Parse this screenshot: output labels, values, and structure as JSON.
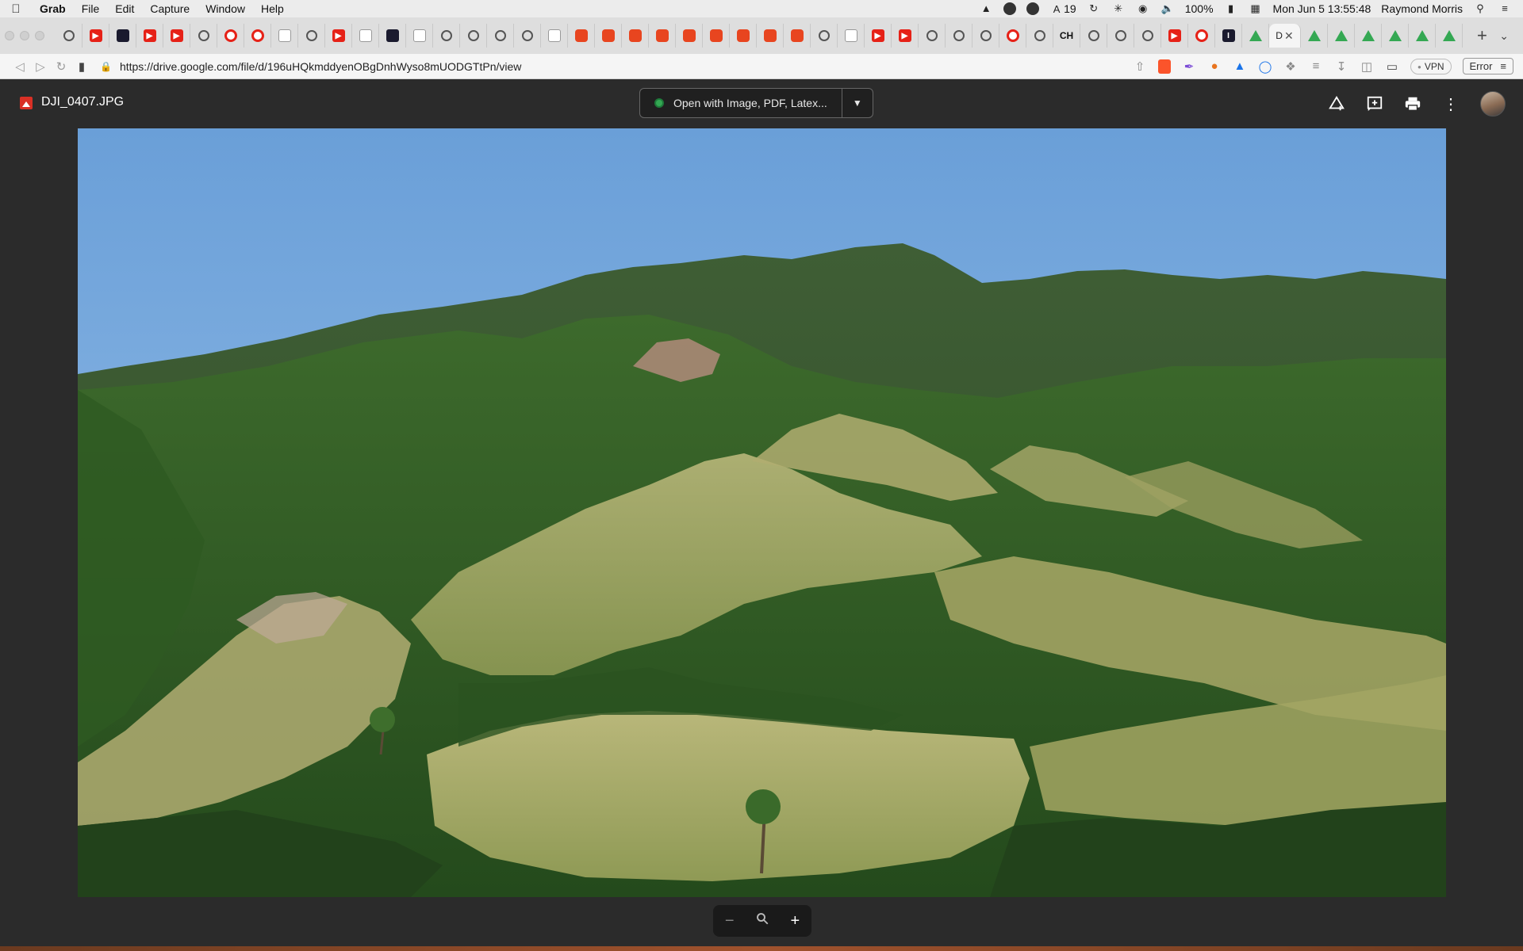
{
  "menubar": {
    "app": "Grab",
    "items": [
      "File",
      "Edit",
      "Capture",
      "Window",
      "Help"
    ],
    "badge_count": "19",
    "battery": "100%",
    "datetime": "Mon Jun 5  13:55:48",
    "user": "Raymond Morris"
  },
  "browser": {
    "url": "https://drive.google.com/file/d/196uHQkmddyenOBgDnhWyso8mUODGTtPn/view",
    "active_tab_label": "D",
    "tab_label_ch": "CH",
    "tab_label_i": "I",
    "vpn_label": "VPN",
    "error_label": "Error"
  },
  "viewer": {
    "file_name": "DJI_0407.JPG",
    "open_with_label": "Open with Image, PDF, Latex..."
  },
  "icons": {
    "zoom_out": "minus-icon",
    "zoom_reset": "magnifier-icon",
    "zoom_in": "plus-icon"
  }
}
